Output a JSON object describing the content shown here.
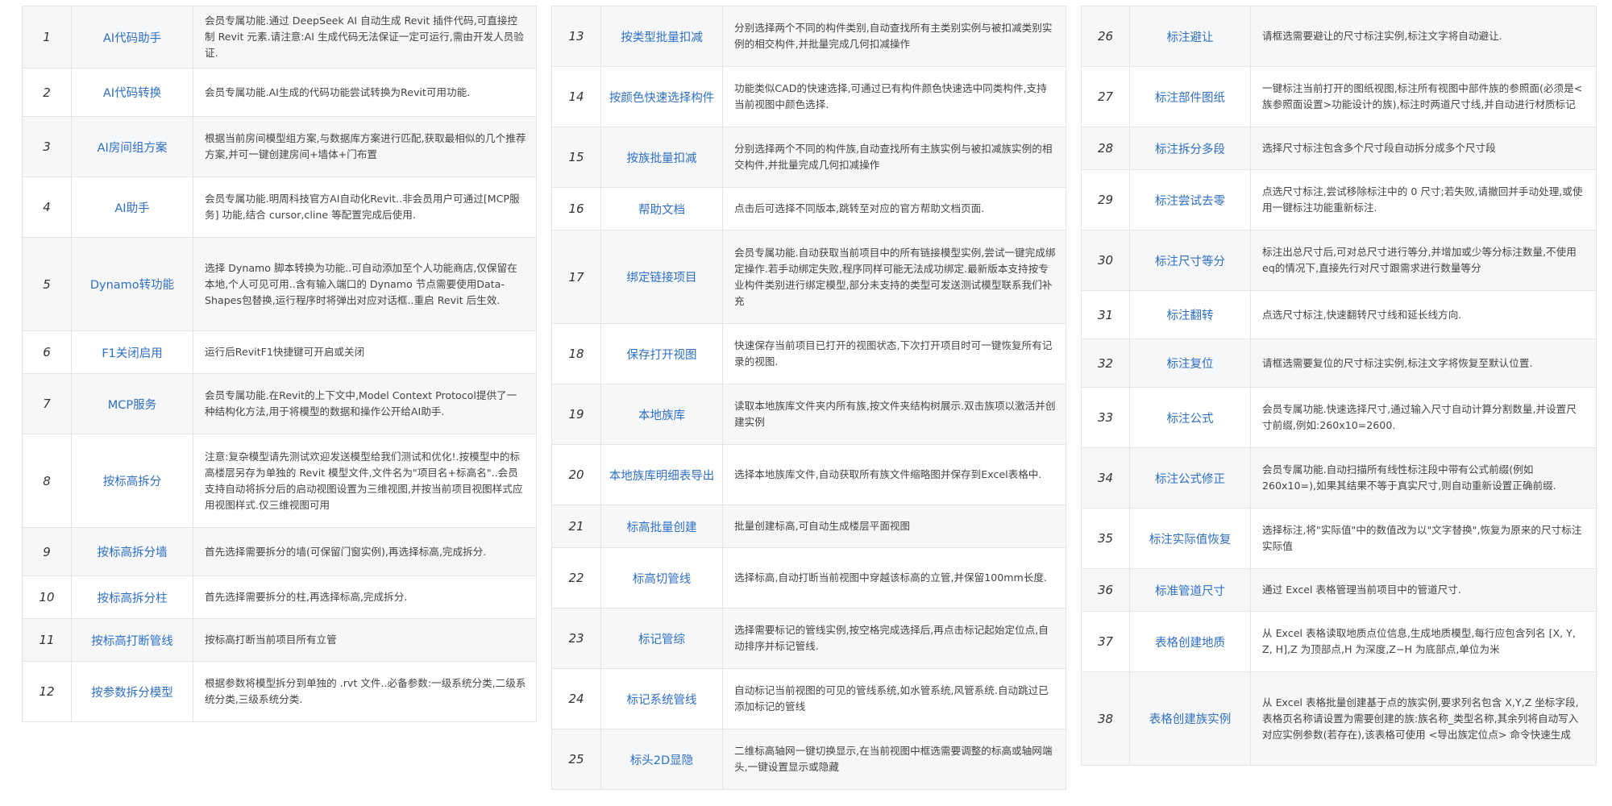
{
  "columns": [
    {
      "rows": [
        {
          "num": "1",
          "name": "AI代码助手",
          "desc": "会员专属功能.通过 DeepSeek AI 自动生成 Revit 插件代码,可直接控制 Revit 元素.请注意:AI 生成代码无法保证一定可运行,需由开发人员验证."
        },
        {
          "num": "2",
          "name": "AI代码转换",
          "desc": "会员专属功能.AI生成的代码功能尝试转换为Revit可用功能."
        },
        {
          "num": "3",
          "name": "AI房间组方案",
          "desc": "根据当前房间模型组方案,与数据库方案进行匹配,获取最相似的几个推荐方案,并可一键创建房间+墙体+门布置"
        },
        {
          "num": "4",
          "name": "AI助手",
          "desc": "会员专属功能.明周科技官方AI自动化Revit..非会员用户可通过[MCP服务] 功能,结合 cursor,cline 等配置完成后使用."
        },
        {
          "num": "5",
          "name": "Dynamo转功能",
          "desc": "选择 Dynamo 脚本转换为功能..可自动添加至个人功能商店,仅保留在本地,个人可见可用..含有输入端口的 Dynamo 节点需要使用Data-Shapes包替换,运行程序时将弹出对应对话框..重启 Revit 后生效."
        },
        {
          "num": "6",
          "name": "F1关闭启用",
          "desc": "运行后RevitF1快捷键可开启或关闭"
        },
        {
          "num": "7",
          "name": "MCP服务",
          "desc": "会员专属功能.在Revit的上下文中,Model Context Protocol提供了一种结构化方法,用于将模型的数据和操作公开给AI助手."
        },
        {
          "num": "8",
          "name": "按标高拆分",
          "desc": "注意:复杂模型请先测试欢迎发送模型给我们测试和优化!.按模型中的标高楼层另存为单独的 Revit 模型文件,文件名为\"项目名+标高名\"..会员支持自动将拆分后的启动视图设置为三维视图,并按当前项目视图样式应用视图样式.仅三维视图可用"
        },
        {
          "num": "9",
          "name": "按标高拆分墙",
          "desc": "首先选择需要拆分的墙(可保留门窗实例),再选择标高,完成拆分."
        },
        {
          "num": "10",
          "name": "按标高拆分柱",
          "desc": "首先选择需要拆分的柱,再选择标高,完成拆分."
        },
        {
          "num": "11",
          "name": "按标高打断管线",
          "desc": "按标高打断当前项目所有立管"
        },
        {
          "num": "12",
          "name": "按参数拆分模型",
          "desc": "根据参数将模型拆分到单独的 .rvt 文件..必备参数:一级系统分类,二级系统分类,三级系统分类."
        }
      ]
    },
    {
      "rows": [
        {
          "num": "13",
          "name": "按类型批量扣减",
          "desc": "分别选择两个不同的构件类别,自动查找所有主类别实例与被扣减类别实例的相交构件,并批量完成几何扣减操作"
        },
        {
          "num": "14",
          "name": "按颜色快速选择构件",
          "desc": "功能类似CAD的快速选择,可通过已有构件颜色快速选中同类构件,支持当前视图中颜色选择."
        },
        {
          "num": "15",
          "name": "按族批量扣减",
          "desc": "分别选择两个不同的构件族,自动查找所有主族实例与被扣减族实例的相交构件,并批量完成几何扣减操作"
        },
        {
          "num": "16",
          "name": "帮助文档",
          "desc": "点击后可选择不同版本,跳转至对应的官方帮助文档页面."
        },
        {
          "num": "17",
          "name": "绑定链接项目",
          "desc": "会员专属功能.自动获取当前项目中的所有链接模型实例,尝试一键完成绑定操作.若手动绑定失败,程序同样可能无法成功绑定.最新版本支持按专业构件类别进行绑定模型,部分未支持的类型可发送测试模型联系我们补充"
        },
        {
          "num": "18",
          "name": "保存打开视图",
          "desc": "快速保存当前项目已打开的视图状态,下次打开项目时可一键恢复所有记录的视图."
        },
        {
          "num": "19",
          "name": "本地族库",
          "desc": "读取本地族库文件夹内所有族,按文件夹结构树展示.双击族项以激活并创建实例"
        },
        {
          "num": "20",
          "name": "本地族库明细表导出",
          "desc": "选择本地族库文件,自动获取所有族文件缩略图并保存到Excel表格中."
        },
        {
          "num": "21",
          "name": "标高批量创建",
          "desc": "批量创建标高,可自动生成楼层平面视图"
        },
        {
          "num": "22",
          "name": "标高切管线",
          "desc": "选择标高,自动打断当前视图中穿越该标高的立管,并保留100mm长度."
        },
        {
          "num": "23",
          "name": "标记管综",
          "desc": "选择需要标记的管线实例,按空格完成选择后,再点击标记起始定位点,自动排序并标记管线."
        },
        {
          "num": "24",
          "name": "标记系统管线",
          "desc": "自动标记当前视图的可见的管线系统,如水管系统,风管系统.自动跳过已添加标记的管线"
        },
        {
          "num": "25",
          "name": "标头2D显隐",
          "desc": "二维标高轴网一键切换显示,在当前视图中框选需要调整的标高或轴网端头,一键设置显示或隐藏"
        }
      ]
    },
    {
      "rows": [
        {
          "num": "26",
          "name": "标注避让",
          "desc": "请框选需要避让的尺寸标注实例,标注文字将自动避让."
        },
        {
          "num": "27",
          "name": "标注部件图纸",
          "desc": "一键标注当前打开的图纸视图,标注所有视图中部件族的参照面(必须是<族参照面设置>功能设计的族),标注时两道尺寸线,并自动进行材质标记"
        },
        {
          "num": "28",
          "name": "标注拆分多段",
          "desc": "选择尺寸标注包含多个尺寸段自动拆分成多个尺寸段"
        },
        {
          "num": "29",
          "name": "标注尝试去零",
          "desc": "点选尺寸标注,尝试移除标注中的 0 尺寸;若失败,请撤回并手动处理,或使用一键标注功能重新标注."
        },
        {
          "num": "30",
          "name": "标注尺寸等分",
          "desc": "标注出总尺寸后,可对总尺寸进行等分,并增加或少等分标注数量,不使用eq的情况下,直接先行对尺寸跟需求进行数量等分"
        },
        {
          "num": "31",
          "name": "标注翻转",
          "desc": "点选尺寸标注,快速翻转尺寸线和延长线方向."
        },
        {
          "num": "32",
          "name": "标注复位",
          "desc": "请框选需要复位的尺寸标注实例,标注文字将恢复至默认位置."
        },
        {
          "num": "33",
          "name": "标注公式",
          "desc": "会员专属功能.快速选择尺寸,通过输入尺寸自动计算分割数量,并设置尺寸前缀,例如:260x10=2600."
        },
        {
          "num": "34",
          "name": "标注公式修正",
          "desc": "会员专属功能.自动扫描所有线性标注段中带有公式前缀(例如260x10=),如果其结果不等于真实尺寸,则自动重新设置正确前缀."
        },
        {
          "num": "35",
          "name": "标注实际值恢复",
          "desc": "选择标注,将\"实际值\"中的数值改为以\"文字替换\",恢复为原来的尺寸标注实际值"
        },
        {
          "num": "36",
          "name": "标准管道尺寸",
          "desc": "通过 Excel 表格管理当前项目中的管道尺寸."
        },
        {
          "num": "37",
          "name": "表格创建地质",
          "desc": "从 Excel 表格读取地质点位信息,生成地质模型,每行应包含列名 [X, Y, Z, H],Z 为顶部点,H 为深度,Z−H 为底部点,单位为米"
        },
        {
          "num": "38",
          "name": "表格创建族实例",
          "desc": "从 Excel 表格批量创建基于点的族实例,要求列名包含 X,Y,Z 坐标字段,表格页名称请设置为需要创建的族:族名称_类型名称,其余列将自动写入对应实例参数(若存在),该表格可使用 <导出族定位点> 命令快速生成"
        }
      ]
    }
  ]
}
